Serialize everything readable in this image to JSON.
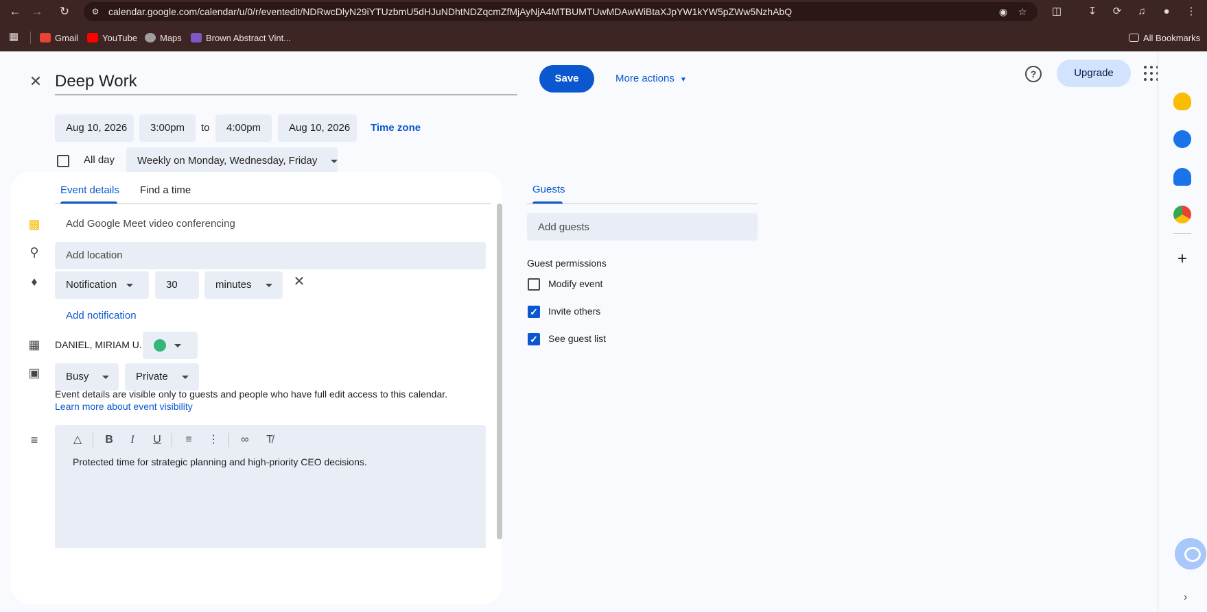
{
  "browser": {
    "url": "calendar.google.com/calendar/u/0/r/eventedit/NDRwcDlyN29iYTUzbmU5dHJuNDhtNDZqcmZfMjAyNjA4MTBUMTUwMDAwWiBtaXJpYW1kYW5pZWw5NzhAbQ",
    "bookmarks": [
      {
        "label": "Gmail",
        "color": "#ea4335"
      },
      {
        "label": "YouTube",
        "color": "#ff0000"
      },
      {
        "label": "Maps",
        "color": "#9e9e9e"
      },
      {
        "label": "Brown Abstract Vint...",
        "color": "#7e57c2"
      }
    ],
    "all_bookmarks": "All Bookmarks"
  },
  "header": {
    "title_value": "Deep Work",
    "save_label": "Save",
    "more_actions_label": "More actions",
    "upgrade_label": "Upgrade"
  },
  "datetime": {
    "start_date": "Aug 10, 2026",
    "start_time": "3:00pm",
    "to_label": "to",
    "end_time": "4:00pm",
    "end_date": "Aug 10, 2026",
    "timezone_label": "Time zone",
    "all_day_label": "All day",
    "all_day_checked": false,
    "recurrence": "Weekly on Monday, Wednesday, Friday"
  },
  "details": {
    "tabs": [
      {
        "label": "Event details",
        "active": true
      },
      {
        "label": "Find a time",
        "active": false
      }
    ],
    "meet_label": "Add Google Meet video conferencing",
    "location_placeholder": "Add location",
    "notification": {
      "type": "Notification",
      "amount": "30",
      "unit": "minutes"
    },
    "add_notification_label": "Add notification",
    "calendar_owner": "DANIEL, MIRIAM U.",
    "calendar_color": "#33b679",
    "availability": "Busy",
    "visibility": "Private",
    "visibility_note": "Event details are visible only to guests and people who have full edit access to this calendar.",
    "visibility_link": "Learn more about event visibility",
    "description": "Protected time for strategic planning and high-priority CEO decisions."
  },
  "guests": {
    "tab_label": "Guests",
    "add_placeholder": "Add guests",
    "permissions_title": "Guest permissions",
    "permissions": [
      {
        "label": "Modify event",
        "checked": false
      },
      {
        "label": "Invite others",
        "checked": true
      },
      {
        "label": "See guest list",
        "checked": true
      }
    ]
  },
  "side_panel": {
    "icons": [
      "keep-icon",
      "tasks-icon",
      "contacts-icon",
      "maps-icon"
    ]
  }
}
